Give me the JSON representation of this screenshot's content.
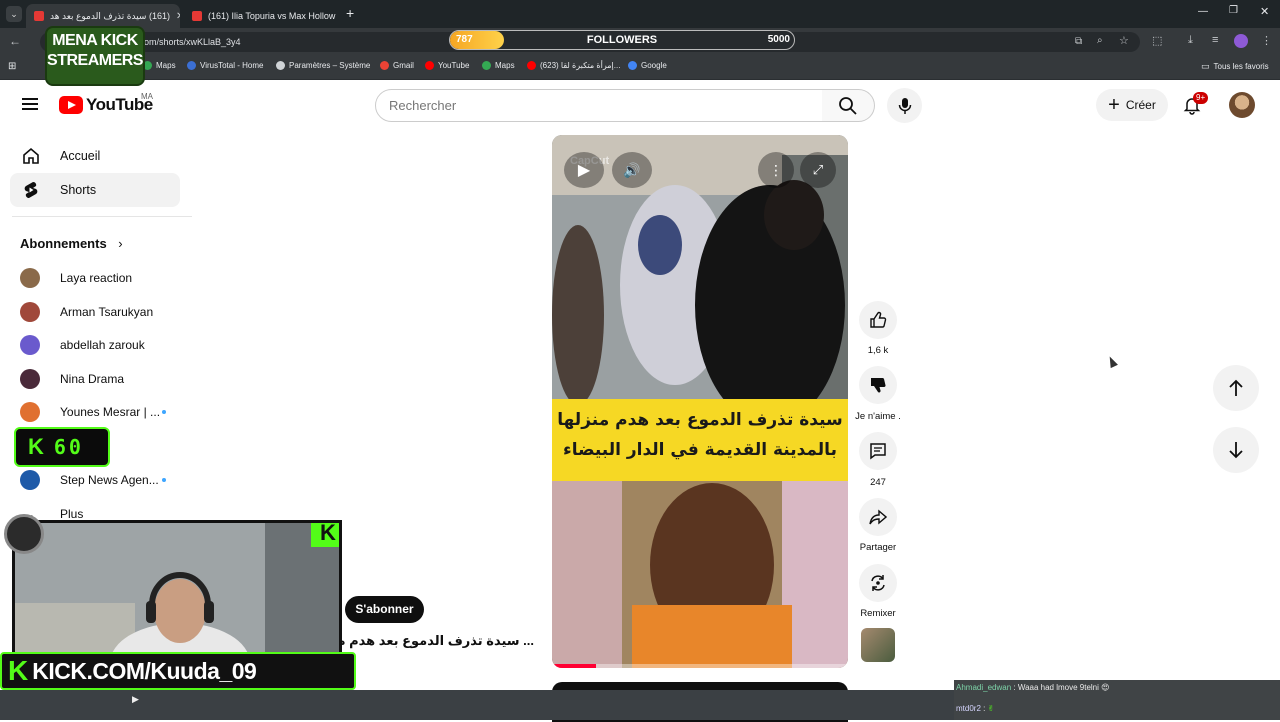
{
  "browser": {
    "tabs": [
      {
        "title": "(161) سيدة تذرف الدموع بعد هد"
      },
      {
        "title": "(161) Ilia Topuria vs Max Hollow"
      }
    ],
    "new_tab": "+",
    "url": "om/shorts/xwKLlaB_3y4",
    "bookmarks": [
      {
        "label": "Maps",
        "icon_color": "#34a853"
      },
      {
        "label": "VirusTotal - Home",
        "icon_color": "#3b6fd4"
      },
      {
        "label": "Paramètres – Système",
        "icon_color": "#cfd3d6"
      },
      {
        "label": "Gmail",
        "icon_color": "#ea4335"
      },
      {
        "label": "YouTube",
        "icon_color": "#ff0000"
      },
      {
        "label": "Maps",
        "icon_color": "#34a853"
      },
      {
        "label": "(623) إمرأة متكبرة لقا...",
        "icon_color": "#ff0000"
      },
      {
        "label": "Google",
        "icon_color": "#4285f4"
      }
    ],
    "all_favorites": "Tous les favoris"
  },
  "youtube": {
    "logo_text": "YouTube",
    "country": "MA",
    "search_placeholder": "Rechercher",
    "create_label": "Créer",
    "notif_count": "9+",
    "sidebar": {
      "items": [
        {
          "label": "Accueil",
          "icon": "home-icon"
        },
        {
          "label": "Shorts",
          "icon": "shorts-icon"
        }
      ],
      "subscriptions_title": "Abonnements",
      "subscriptions": [
        {
          "name": "Laya reaction",
          "color": "#8a6a4a",
          "new": false
        },
        {
          "name": "Arman Tsarukyan",
          "color": "#a0483a",
          "new": false
        },
        {
          "name": "abdellah zarouk",
          "color": "#6a5acd",
          "new": false
        },
        {
          "name": "Nina Drama",
          "color": "#4a2a3a",
          "new": false
        },
        {
          "name": "Younes Mesrar | ...",
          "color": "#e07030",
          "new": true
        },
        {
          "name": "Step News Agen...",
          "color": "#1e5aa8",
          "new": true
        }
      ],
      "more_label": "Plus"
    },
    "short": {
      "caption_line1": "سيدة تذرف الدموع بعد هدم منزلها",
      "caption_line2": "بالمدينة القديمة في الدار البيضاء",
      "watermark": "CapCut",
      "title": "... سيدة تذرف الدموع بعد هدم منزلها",
      "subscribe_label": "S'abonner",
      "progress": 0.15
    },
    "actions": {
      "likes": "1,6 k",
      "dislike_label": "Je n'aime .",
      "comments": "247",
      "share_label": "Partager",
      "remix_label": "Remixer"
    }
  },
  "stream_overlay": {
    "followers_title": "FOLLOWERS",
    "followers_current": "787",
    "followers_goal": "5000",
    "followers_progress": 0.157,
    "logo_line1": "MENA KICK",
    "logo_line2": "STREAMERS",
    "k_counter": "60",
    "kick_url": "KICK.COM/Kuuda_09",
    "chat": [
      {
        "user": "Ahmadi_edwan",
        "text": "Waaa had lmove 9telni 😍"
      },
      {
        "user": "mtd0r2",
        "text": "✌"
      }
    ]
  }
}
